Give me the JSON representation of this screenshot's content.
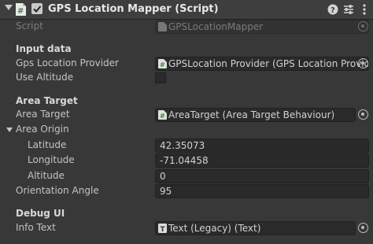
{
  "header": {
    "title": "GPS Location Mapper (Script)",
    "enabled": true,
    "icons": [
      "help-icon",
      "presets-icon",
      "more-icon"
    ]
  },
  "script": {
    "label": "Script",
    "value": "GPSLocationMapper"
  },
  "sections": {
    "input_data": "Input data",
    "area_target": "Area Target",
    "debug_ui": "Debug UI"
  },
  "fields": {
    "gps_location_provider": {
      "label": "Gps Location Provider",
      "value": "GPSLocation Provider (GPS Location Provid"
    },
    "use_altitude": {
      "label": "Use Altitude",
      "checked": false
    },
    "area_target": {
      "label": "Area Target",
      "value": "AreaTarget (Area Target Behaviour)"
    },
    "area_origin": {
      "label": "Area Origin",
      "expanded": true
    },
    "latitude": {
      "label": "Latitude",
      "value": "42.35073"
    },
    "longitude": {
      "label": "Longitude",
      "value": "-71.04458"
    },
    "altitude": {
      "label": "Altitude",
      "value": "0"
    },
    "orientation_angle": {
      "label": "Orientation Angle",
      "value": "95"
    },
    "info_text": {
      "label": "Info Text",
      "value": "Text (Legacy) (Text)"
    }
  },
  "colors": {
    "background": "#383838",
    "header": "#3e3e3e",
    "field": "#2a2a2a",
    "script_icon": "#4a9a4f"
  }
}
